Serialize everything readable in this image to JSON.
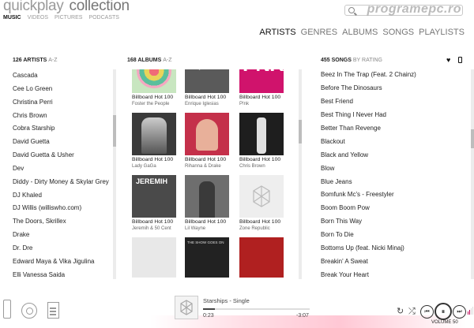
{
  "app": {
    "name": "quickplay",
    "section": "collection"
  },
  "subnav": [
    "MUSIC",
    "VIDEOS",
    "PICTURES",
    "PODCASTS"
  ],
  "watermark": "programepc.ro",
  "view_tabs": [
    "ARTISTS",
    "GENRES",
    "ALBUMS",
    "SONGS",
    "PLAYLISTS"
  ],
  "artists": {
    "count_label": "126 ARTISTS",
    "sort_label": "A-Z",
    "items": [
      "Cascada",
      "Cee Lo Green",
      "Christina Perri",
      "Chris Brown",
      "Cobra Starship",
      "David Guetta",
      "David Guetta & Usher",
      "Dev",
      "Diddy - Dirty Money & Skylar Grey",
      "DJ Khaled",
      "DJ Willis (williswho.com)",
      "The Doors, Skrillex",
      "Drake",
      "Dr. Dre",
      "Edward Maya & Vika Jigulina",
      "Elli Vanessa Saida"
    ]
  },
  "albums": {
    "count_label": "168 ALBUMS",
    "sort_label": "A-Z",
    "items": [
      {
        "title": "Billboard Hot 100",
        "artist": "Foster the People",
        "color": "#c8e6c0"
      },
      {
        "title": "Billboard Hot 100",
        "artist": "Enrique Iglesias",
        "color": "#5a5a5a"
      },
      {
        "title": "Billboard Hot 100",
        "artist": "P!nk",
        "color": "#d0136c"
      },
      {
        "title": "Billboard Hot 100",
        "artist": "Lady GaGa",
        "color": "#3a3a3a"
      },
      {
        "title": "Billboard Hot 100",
        "artist": "Rihanna & Drake",
        "color": "#c4304a"
      },
      {
        "title": "Billboard Hot 100",
        "artist": "Chris Brown",
        "color": "#1e1e1e"
      },
      {
        "title": "Billboard Hot 100",
        "artist": "Jeremih & 50 Cent",
        "color": "#4a4a4a"
      },
      {
        "title": "Billboard Hot 100",
        "artist": "Lil Wayne",
        "color": "#6e6e6e"
      },
      {
        "title": "Billboard Hot 100",
        "artist": "Zone Republic",
        "color": "#eeeeee"
      },
      {
        "title": "",
        "artist": "",
        "color": "#e8e8e8"
      },
      {
        "title": "",
        "artist": "",
        "color": "#222222"
      },
      {
        "title": "",
        "artist": "",
        "color": "#b02020"
      }
    ],
    "cover_captions": {
      "enrique": "ENRIQUE IGLESIAS",
      "pink": "PNK",
      "jeremih": "JEREMIH",
      "show": "THE SHOW GOES ON"
    }
  },
  "songs": {
    "count_label": "455 SONGS",
    "sort_label": "BY RATING",
    "items": [
      "Beez In The Trap (Feat. 2 Chainz)",
      "Before The Dinosaurs",
      "Best Friend",
      "Best Thing I Never Had",
      "Better Than Revenge",
      "Blackout",
      "Black and Yellow",
      "Blow",
      "Blue Jeans",
      "Bomfunk Mc's - Freestyler",
      "Boom Boom Pow",
      "Born This Way",
      "Born To Die",
      "Bottoms Up (feat. Nicki Minaj)",
      "Breakin' A Sweat",
      "Break Your Heart"
    ]
  },
  "now_playing": {
    "title": "Starships - Single",
    "elapsed": "0:23",
    "remaining": "-3:07",
    "progress": 0.11
  },
  "controls": {
    "repeat_icon": "↻",
    "shuffle_icon": "⤮",
    "prev_icon": "⏮",
    "pause_icon": "⏸",
    "next_icon": "⏭",
    "volume_label": "VOLUME 50",
    "volume": 50
  },
  "colors": {
    "accent": "#c0005a",
    "text": "#222222",
    "muted": "#9a9a9a"
  }
}
